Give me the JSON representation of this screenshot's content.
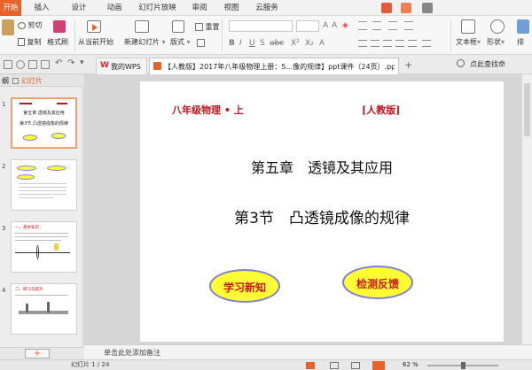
{
  "tabs": [
    "开始",
    "插入",
    "设计",
    "动画",
    "幻灯片放映",
    "审阅",
    "视图",
    "云服务"
  ],
  "ribbon": {
    "cut": "剪切",
    "copy": "复制",
    "format_painter": "格式刷",
    "from_current": "从当前开始",
    "new_slide": "新建幻灯片",
    "layout": "版式",
    "reset": "重置",
    "textbox": "文本框",
    "shape": "形状",
    "arrange": "排"
  },
  "docbar": {
    "wps_tab": "我的WPS",
    "doc_title": "【人教版】2017年八年级物理上册：5...像的规律】ppt课件（24页）.ppt",
    "search_hint": "点此查找命"
  },
  "leftpane": {
    "tab_outline": "纲",
    "tab_slides": "幻灯片",
    "add_button": "+"
  },
  "thumbs": [
    {
      "num": "1",
      "line1": "第五章",
      "line2": "透镜及其应用",
      "line3": "第3节  凸透镜成像的规律"
    },
    {
      "num": "2"
    },
    {
      "num": "3",
      "title": "一、基本知识："
    },
    {
      "num": "4",
      "title": "二、练习与提升"
    }
  ],
  "slide": {
    "grade": "八年级物理 • 上",
    "edition": "[人教版]",
    "chapter": "第五章　透镜及其应用",
    "section": "第3节　凸透镜成像的规律",
    "button_learn": "学习新知",
    "button_test": "检测反馈"
  },
  "notes_placeholder": "单击此处添加备注",
  "status": {
    "slide_counter": "幻灯片 1 / 24",
    "zoom": "62 %"
  },
  "colors": {
    "accent": "#e8632a",
    "slide_red": "#c0141c",
    "ellipse_fill": "#ffff33",
    "ellipse_border": "#7a7fd6",
    "ellipse_text": "#d01414"
  }
}
